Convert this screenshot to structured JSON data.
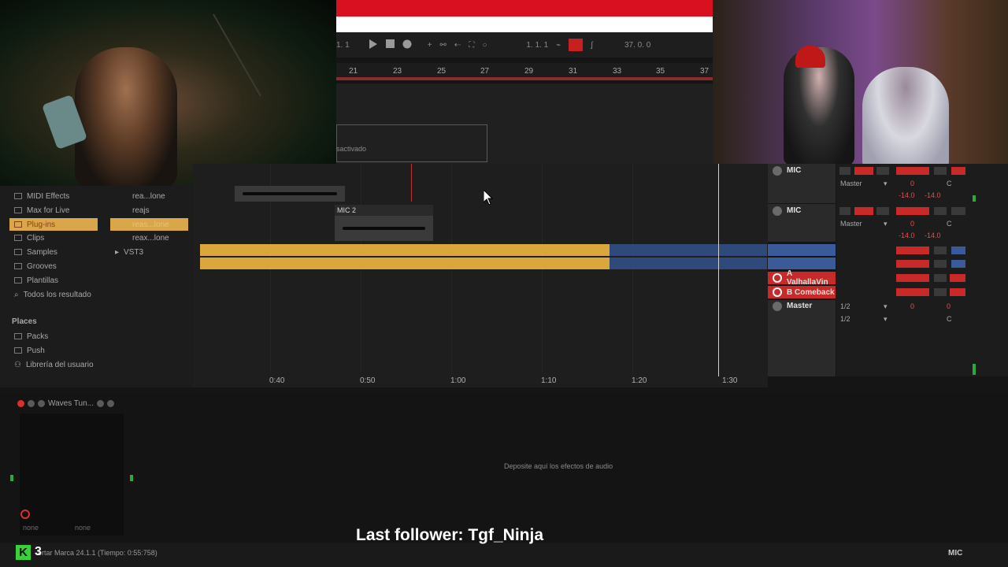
{
  "transport": {
    "position_left": "1. 1",
    "position_mid": "1. 1. 1",
    "tempo_right": "37. 0. 0"
  },
  "ruler": {
    "bars": [
      "21",
      "23",
      "25",
      "27",
      "29",
      "31",
      "33",
      "35",
      "37"
    ]
  },
  "arrange_top": {
    "deactivated_text": "sactivado"
  },
  "browser": {
    "categories": [
      {
        "label": "MIDI Effects"
      },
      {
        "label": "Max for Live"
      },
      {
        "label": "Plug-ins"
      },
      {
        "label": "Clips"
      },
      {
        "label": "Samples"
      },
      {
        "label": "Grooves"
      },
      {
        "label": "Plantillas"
      },
      {
        "label": "Todos los resultado"
      }
    ],
    "items": [
      {
        "label": "rea...lone"
      },
      {
        "label": "reajs"
      },
      {
        "label": "reas...lone"
      },
      {
        "label": "reax...lone"
      },
      {
        "label": "VST3"
      }
    ],
    "places_header": "Places",
    "places": [
      {
        "label": "Packs"
      },
      {
        "label": "Push"
      },
      {
        "label": "Librería del usuario"
      }
    ]
  },
  "clips": {
    "mic2_label": "MIC 2"
  },
  "timeline": {
    "labels": [
      "0:40",
      "0:50",
      "1:00",
      "1:10",
      "1:20",
      "1:30"
    ]
  },
  "tracks": {
    "mic1": "MIC",
    "mic2": "MIC",
    "return_a": "A ValhallaVin",
    "return_b": "B Comeback",
    "master": "Master"
  },
  "mixer": {
    "routing1": "Master",
    "routing2": "Master",
    "vol_value": "0",
    "pan_value": "C",
    "peak_left": "-14.0",
    "peak_right": "-14.0",
    "master_in1": "1/2",
    "master_in2": "1/2",
    "master_vol": "0",
    "master_pan": "C"
  },
  "device": {
    "name": "Waves Tun...",
    "drop_text": "Deposite aquí los efectos de audio",
    "select_a": "none",
    "select_b": "none"
  },
  "status": {
    "text": "ertar Marca 24.1.1 (Tiempo: 0:55:758)",
    "track_name": "MIC"
  },
  "overlay": {
    "kick_logo": "K",
    "kick_count": "3",
    "follower": "Last follower: Tgf_Ninja"
  },
  "colors": {
    "accent_orange": "#d9a74a",
    "clip_yellow": "#d9a73a",
    "clip_blue": "#2f4a7a",
    "track_red": "#c82a2a",
    "kick_green": "#3ad03a"
  }
}
